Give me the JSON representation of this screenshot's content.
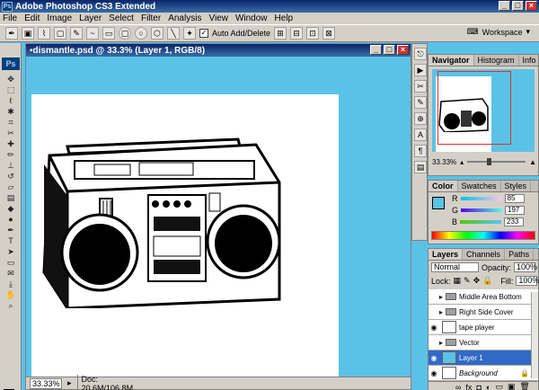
{
  "app": {
    "title": "Adobe Photoshop CS3 Extended",
    "logo": "Ps"
  },
  "menu": [
    "File",
    "Edit",
    "Image",
    "Layer",
    "Select",
    "Filter",
    "Analysis",
    "View",
    "Window",
    "Help"
  ],
  "options": {
    "auto_add_delete": "Auto Add/Delete",
    "workspace": "Workspace"
  },
  "document": {
    "title": "dismantle.psd @ 33.3% (Layer 1, RGB/8)",
    "zoom": "33.33%",
    "doc_info": "Doc: 20.6M/106.8M"
  },
  "navigator": {
    "tabs": [
      "Navigator",
      "Histogram",
      "Info"
    ],
    "zoom": "33.33%"
  },
  "color": {
    "tabs": [
      "Color",
      "Swatches",
      "Styles"
    ],
    "channels": [
      {
        "label": "R",
        "value": "85"
      },
      {
        "label": "G",
        "value": "197"
      },
      {
        "label": "B",
        "value": "233"
      }
    ],
    "foreground": "#5bc2e7"
  },
  "layers": {
    "tabs": [
      "Layers",
      "Channels",
      "Paths"
    ],
    "blend_mode": "Normal",
    "opacity_label": "Opacity:",
    "opacity": "100%",
    "lock_label": "Lock:",
    "fill_label": "Fill:",
    "fill": "100%",
    "items": [
      {
        "name": "Middle Area Bottom",
        "type": "folder",
        "visible": false
      },
      {
        "name": "Right Side Cover",
        "type": "folder",
        "visible": false
      },
      {
        "name": "tape player",
        "type": "layer",
        "visible": true
      },
      {
        "name": "Vector",
        "type": "folder",
        "visible": false
      },
      {
        "name": "Layer 1",
        "type": "layer",
        "visible": true,
        "active": true
      },
      {
        "name": "Background",
        "type": "layer",
        "visible": true
      }
    ]
  },
  "colors": {
    "accent": "#316ac5",
    "sky": "#5bc2e7",
    "titlebar": "#0a246a",
    "chrome": "#d4d0c8"
  }
}
